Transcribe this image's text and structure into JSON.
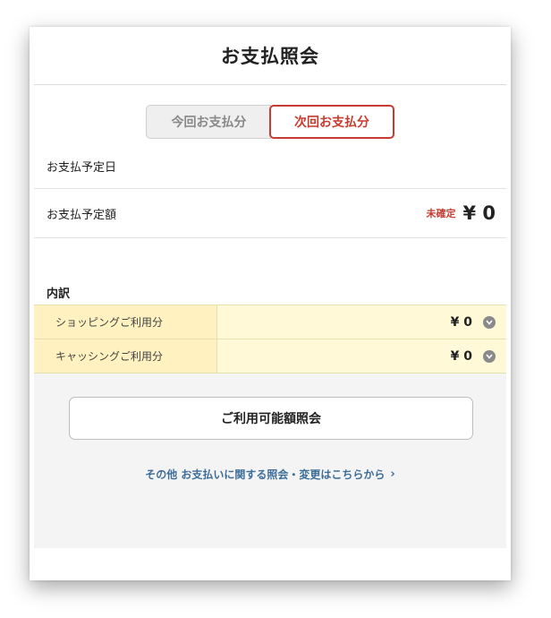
{
  "header": {
    "title": "お支払照会"
  },
  "tabs": [
    {
      "label": "今回お支払分",
      "selected": false
    },
    {
      "label": "次回お支払分",
      "selected": true
    }
  ],
  "rows": {
    "scheduled_date_label": "お支払予定日",
    "scheduled_date_value": "",
    "scheduled_amount_label": "お支払予定額",
    "undetermined_badge": "未確定",
    "scheduled_amount_value": "¥ 0"
  },
  "breakdown": {
    "title": "内訳",
    "items": [
      {
        "label": "ショッピングご利用分",
        "value": "¥ 0"
      },
      {
        "label": "キャッシングご利用分",
        "value": "¥ 0"
      }
    ]
  },
  "credit_button_label": "ご利用可能額照会",
  "other_link": {
    "text": "その他 お支払いに関する照会・変更はこちらから",
    "arrow": "›"
  },
  "colors": {
    "accent_red": "#c83b2f",
    "link_blue": "#3d6e9a",
    "breakdown_bg": "#fff2c0"
  }
}
